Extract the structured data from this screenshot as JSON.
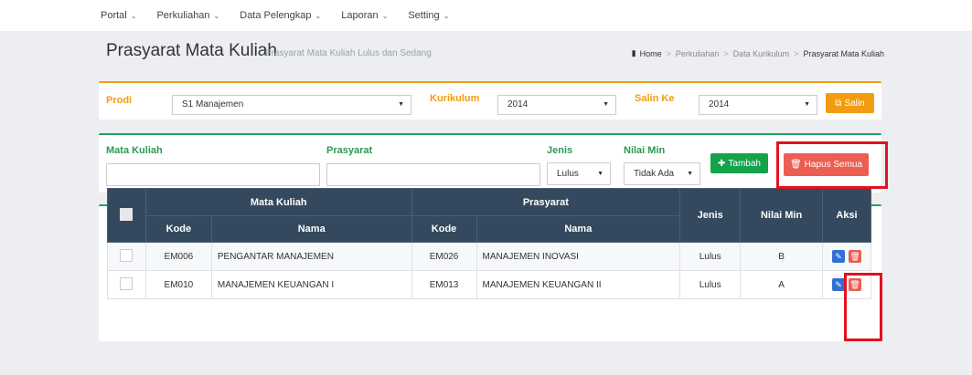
{
  "nav": {
    "items": [
      {
        "label": "Portal"
      },
      {
        "label": "Perkuliahan"
      },
      {
        "label": "Data Pelengkap"
      },
      {
        "label": "Laporan"
      },
      {
        "label": "Setting"
      }
    ]
  },
  "header": {
    "title": "Prasyarat Mata Kuliah",
    "subtitle": "Prasyarat Mata Kuliah Lulus dan Sedang"
  },
  "breadcrumb": {
    "items": [
      "Home",
      "Perkuliahan",
      "Data Kurikulum",
      "Prasyarat Mata Kuliah"
    ]
  },
  "filter": {
    "prodi_label": "Prodi",
    "prodi_value": "S1 Manajemen",
    "kurikulum_label": "Kurikulum",
    "kurikulum_value": "2014",
    "salin_ke_label": "Salin Ke",
    "salin_ke_value": "2014",
    "salin_button": "Salin"
  },
  "form": {
    "mata_kuliah_label": "Mata Kuliah",
    "mata_kuliah_value": "",
    "prasyarat_label": "Prasyarat",
    "prasyarat_value": "",
    "jenis_label": "Jenis",
    "jenis_value": "Lulus",
    "nilai_min_label": "Nilai Min",
    "nilai_min_value": "Tidak Ada",
    "tambah_button": "Tambah",
    "hapus_semua_button": "Hapus Semua"
  },
  "table": {
    "group_headers": {
      "mata_kuliah": "Mata Kuliah",
      "prasyarat": "Prasyarat",
      "jenis": "Jenis",
      "nilai_min": "Nilai Min",
      "aksi": "Aksi"
    },
    "sub_headers": {
      "mk_kode": "Kode",
      "mk_nama": "Nama",
      "pr_kode": "Kode",
      "pr_nama": "Nama"
    },
    "rows": [
      {
        "mk_kode": "EM006",
        "mk_nama": "PENGANTAR MANAJEMEN",
        "pr_kode": "EM026",
        "pr_nama": "MANAJEMEN INOVASI",
        "jenis": "Lulus",
        "nilai_min": "B"
      },
      {
        "mk_kode": "EM010",
        "mk_nama": "MANAJEMEN KEUANGAN I",
        "pr_kode": "EM013",
        "pr_nama": "MANAJEMEN KEUANGAN II",
        "jenis": "Lulus",
        "nilai_min": "A"
      }
    ]
  },
  "colors": {
    "orange": "#f39c12",
    "green": "#14a24a",
    "red": "#ed5e52",
    "table_header": "#34495e",
    "highlight": "#e3121e"
  }
}
